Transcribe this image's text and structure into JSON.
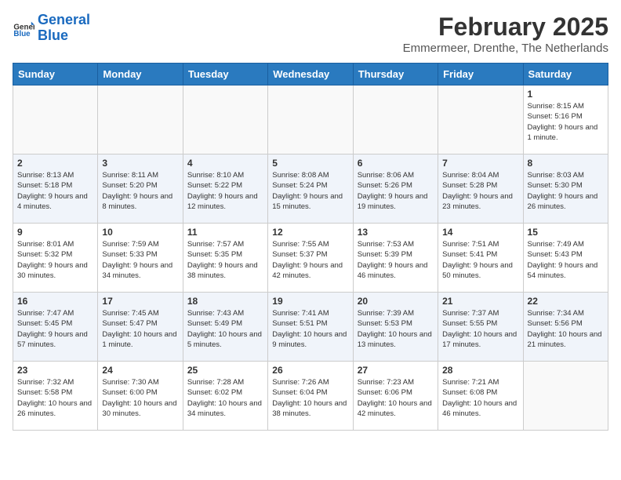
{
  "logo": {
    "text_general": "General",
    "text_blue": "Blue"
  },
  "header": {
    "month": "February 2025",
    "location": "Emmermeer, Drenthe, The Netherlands"
  },
  "days_of_week": [
    "Sunday",
    "Monday",
    "Tuesday",
    "Wednesday",
    "Thursday",
    "Friday",
    "Saturday"
  ],
  "weeks": [
    [
      {
        "day": "",
        "info": ""
      },
      {
        "day": "",
        "info": ""
      },
      {
        "day": "",
        "info": ""
      },
      {
        "day": "",
        "info": ""
      },
      {
        "day": "",
        "info": ""
      },
      {
        "day": "",
        "info": ""
      },
      {
        "day": "1",
        "info": "Sunrise: 8:15 AM\nSunset: 5:16 PM\nDaylight: 9 hours and 1 minute."
      }
    ],
    [
      {
        "day": "2",
        "info": "Sunrise: 8:13 AM\nSunset: 5:18 PM\nDaylight: 9 hours and 4 minutes."
      },
      {
        "day": "3",
        "info": "Sunrise: 8:11 AM\nSunset: 5:20 PM\nDaylight: 9 hours and 8 minutes."
      },
      {
        "day": "4",
        "info": "Sunrise: 8:10 AM\nSunset: 5:22 PM\nDaylight: 9 hours and 12 minutes."
      },
      {
        "day": "5",
        "info": "Sunrise: 8:08 AM\nSunset: 5:24 PM\nDaylight: 9 hours and 15 minutes."
      },
      {
        "day": "6",
        "info": "Sunrise: 8:06 AM\nSunset: 5:26 PM\nDaylight: 9 hours and 19 minutes."
      },
      {
        "day": "7",
        "info": "Sunrise: 8:04 AM\nSunset: 5:28 PM\nDaylight: 9 hours and 23 minutes."
      },
      {
        "day": "8",
        "info": "Sunrise: 8:03 AM\nSunset: 5:30 PM\nDaylight: 9 hours and 26 minutes."
      }
    ],
    [
      {
        "day": "9",
        "info": "Sunrise: 8:01 AM\nSunset: 5:32 PM\nDaylight: 9 hours and 30 minutes."
      },
      {
        "day": "10",
        "info": "Sunrise: 7:59 AM\nSunset: 5:33 PM\nDaylight: 9 hours and 34 minutes."
      },
      {
        "day": "11",
        "info": "Sunrise: 7:57 AM\nSunset: 5:35 PM\nDaylight: 9 hours and 38 minutes."
      },
      {
        "day": "12",
        "info": "Sunrise: 7:55 AM\nSunset: 5:37 PM\nDaylight: 9 hours and 42 minutes."
      },
      {
        "day": "13",
        "info": "Sunrise: 7:53 AM\nSunset: 5:39 PM\nDaylight: 9 hours and 46 minutes."
      },
      {
        "day": "14",
        "info": "Sunrise: 7:51 AM\nSunset: 5:41 PM\nDaylight: 9 hours and 50 minutes."
      },
      {
        "day": "15",
        "info": "Sunrise: 7:49 AM\nSunset: 5:43 PM\nDaylight: 9 hours and 54 minutes."
      }
    ],
    [
      {
        "day": "16",
        "info": "Sunrise: 7:47 AM\nSunset: 5:45 PM\nDaylight: 9 hours and 57 minutes."
      },
      {
        "day": "17",
        "info": "Sunrise: 7:45 AM\nSunset: 5:47 PM\nDaylight: 10 hours and 1 minute."
      },
      {
        "day": "18",
        "info": "Sunrise: 7:43 AM\nSunset: 5:49 PM\nDaylight: 10 hours and 5 minutes."
      },
      {
        "day": "19",
        "info": "Sunrise: 7:41 AM\nSunset: 5:51 PM\nDaylight: 10 hours and 9 minutes."
      },
      {
        "day": "20",
        "info": "Sunrise: 7:39 AM\nSunset: 5:53 PM\nDaylight: 10 hours and 13 minutes."
      },
      {
        "day": "21",
        "info": "Sunrise: 7:37 AM\nSunset: 5:55 PM\nDaylight: 10 hours and 17 minutes."
      },
      {
        "day": "22",
        "info": "Sunrise: 7:34 AM\nSunset: 5:56 PM\nDaylight: 10 hours and 21 minutes."
      }
    ],
    [
      {
        "day": "23",
        "info": "Sunrise: 7:32 AM\nSunset: 5:58 PM\nDaylight: 10 hours and 26 minutes."
      },
      {
        "day": "24",
        "info": "Sunrise: 7:30 AM\nSunset: 6:00 PM\nDaylight: 10 hours and 30 minutes."
      },
      {
        "day": "25",
        "info": "Sunrise: 7:28 AM\nSunset: 6:02 PM\nDaylight: 10 hours and 34 minutes."
      },
      {
        "day": "26",
        "info": "Sunrise: 7:26 AM\nSunset: 6:04 PM\nDaylight: 10 hours and 38 minutes."
      },
      {
        "day": "27",
        "info": "Sunrise: 7:23 AM\nSunset: 6:06 PM\nDaylight: 10 hours and 42 minutes."
      },
      {
        "day": "28",
        "info": "Sunrise: 7:21 AM\nSunset: 6:08 PM\nDaylight: 10 hours and 46 minutes."
      },
      {
        "day": "",
        "info": ""
      }
    ]
  ]
}
